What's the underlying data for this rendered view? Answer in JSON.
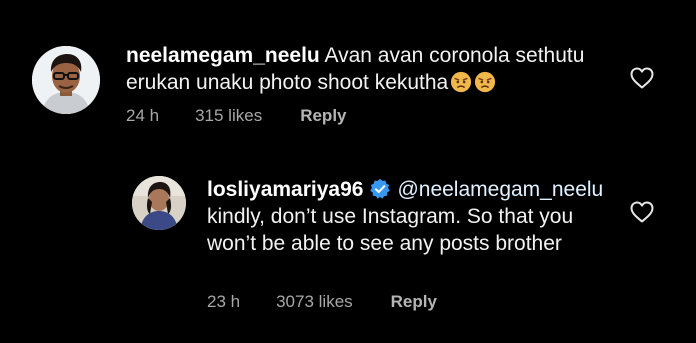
{
  "comments": [
    {
      "username": "neelamegam_neelu",
      "text": "Avan avan coronola sethutu erukan unaku photo shoot kekutha",
      "emoji": "angry-face-emoji",
      "time": "24 h",
      "likes": "315 likes",
      "reply_label": "Reply",
      "verified": false
    },
    {
      "username": "losliyamariya96",
      "mention": "@neelamegam_neelu",
      "text": " kindly, don’t use Instagram. So that you won’t be able to see any posts brother",
      "time": "23 h",
      "likes": "3073 likes",
      "reply_label": "Reply",
      "verified": true
    }
  ],
  "icons": {
    "like": "heart-outline-icon",
    "verified": "verified-badge-icon"
  },
  "colors": {
    "background": "#000000",
    "text": "#f2f2f2",
    "meta": "#a8a8a8",
    "verified_blue": "#3897f0",
    "emoji_red": "#e8543c"
  }
}
